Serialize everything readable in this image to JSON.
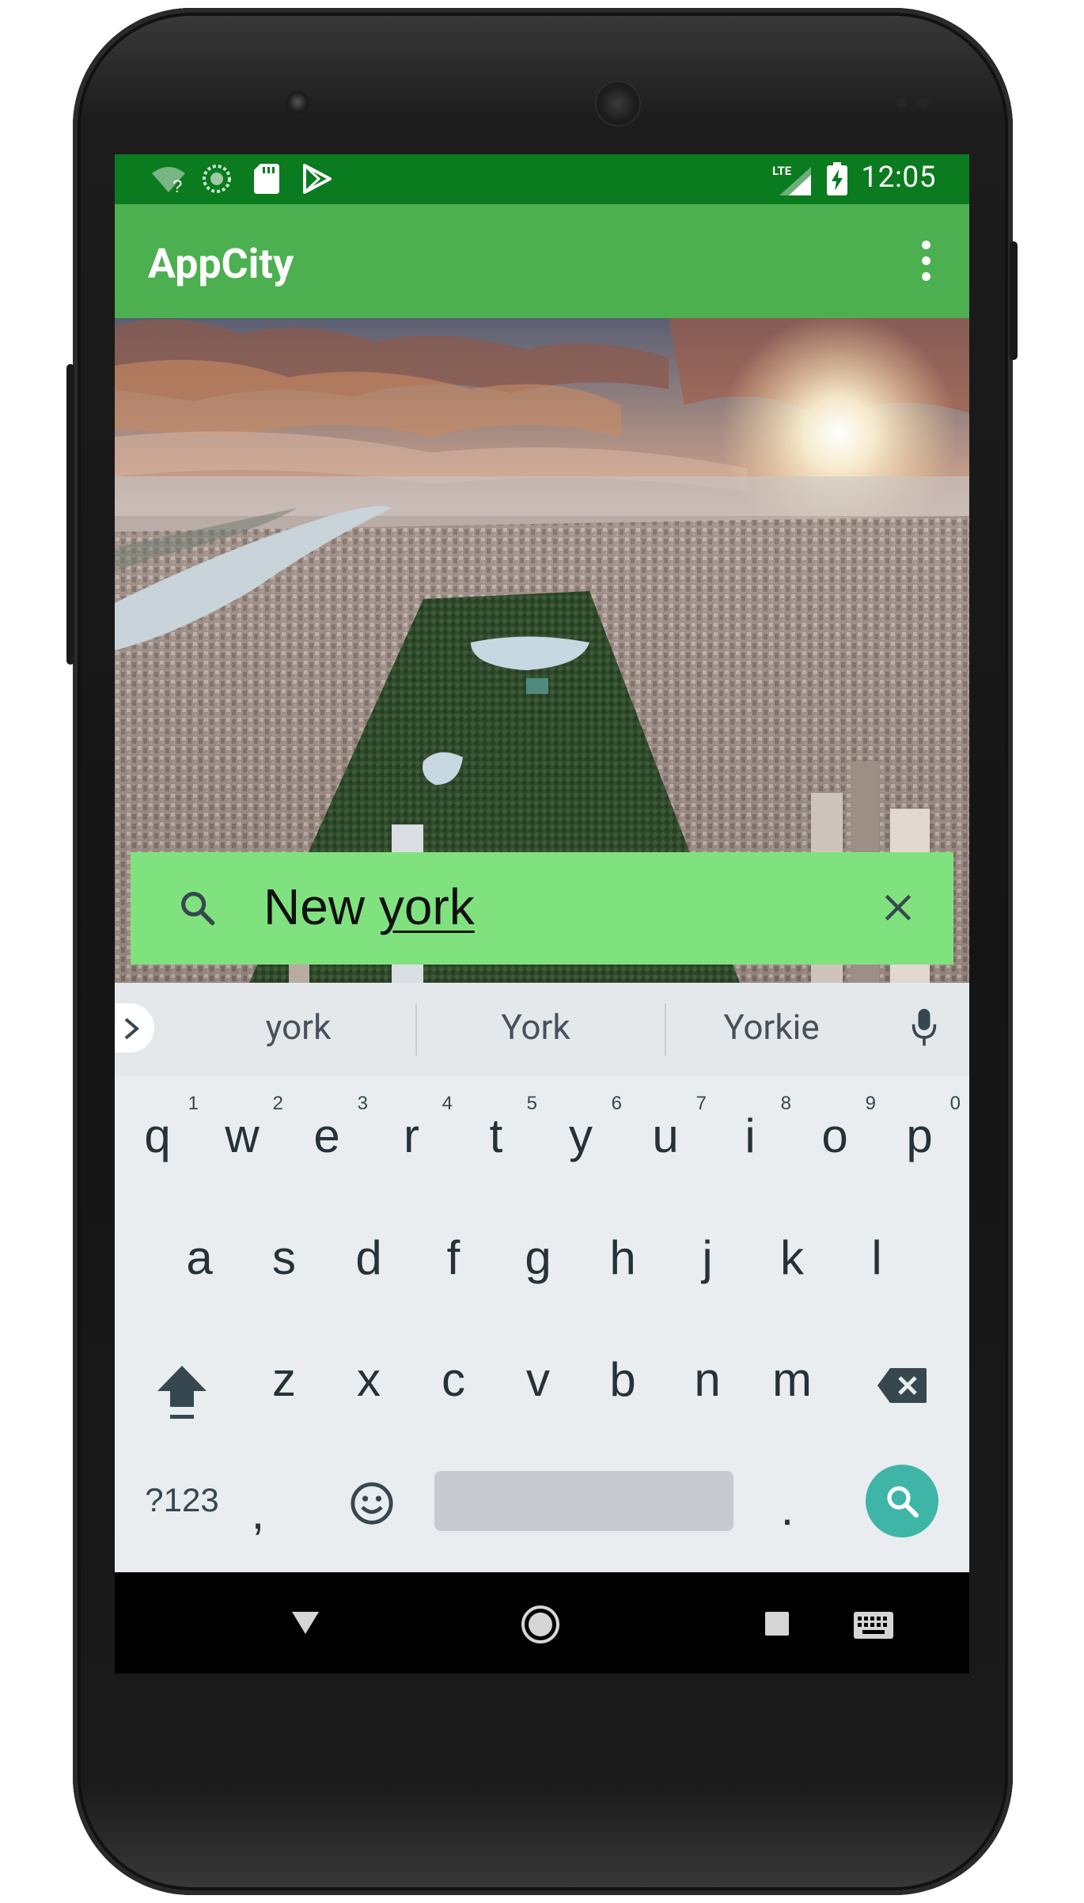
{
  "status_bar": {
    "time": "12:05",
    "network_label": "LTE",
    "icons": [
      "wifi-question-icon",
      "sync-circle-icon",
      "sd-card-icon",
      "play-store-icon",
      "signal-icon",
      "battery-charging-icon"
    ]
  },
  "app_bar": {
    "title": "AppCity",
    "menu_icon": "more-vert-icon"
  },
  "search": {
    "prefix": "New ",
    "typed": "york",
    "search_icon": "search-icon",
    "clear_icon": "close-icon"
  },
  "keyboard": {
    "suggestions": [
      "york",
      "York",
      "Yorkie"
    ],
    "row1": [
      {
        "ch": "q",
        "hint": "1"
      },
      {
        "ch": "w",
        "hint": "2"
      },
      {
        "ch": "e",
        "hint": "3"
      },
      {
        "ch": "r",
        "hint": "4"
      },
      {
        "ch": "t",
        "hint": "5"
      },
      {
        "ch": "y",
        "hint": "6"
      },
      {
        "ch": "u",
        "hint": "7"
      },
      {
        "ch": "i",
        "hint": "8"
      },
      {
        "ch": "o",
        "hint": "9"
      },
      {
        "ch": "p",
        "hint": "0"
      }
    ],
    "row2": [
      "a",
      "s",
      "d",
      "f",
      "g",
      "h",
      "j",
      "k",
      "l"
    ],
    "row3": [
      "z",
      "x",
      "c",
      "v",
      "b",
      "n",
      "m"
    ],
    "row4": {
      "symbols_label": "?123",
      "comma": ",",
      "period": "."
    },
    "icons": {
      "shift": "shift-icon",
      "backspace": "backspace-icon",
      "emoji": "emoji-icon",
      "go": "search-icon",
      "mic": "mic-icon",
      "expand": "chevron-right-icon"
    },
    "accent_color": "#3fb5a8"
  },
  "nav_bar": {
    "icons": [
      "back-triangle-icon",
      "home-circle-icon",
      "recents-square-icon",
      "keyboard-switch-icon"
    ]
  },
  "colors": {
    "status_bar": "#0a7b1e",
    "app_bar": "#4caf50",
    "search_bar": "#80e27e"
  }
}
